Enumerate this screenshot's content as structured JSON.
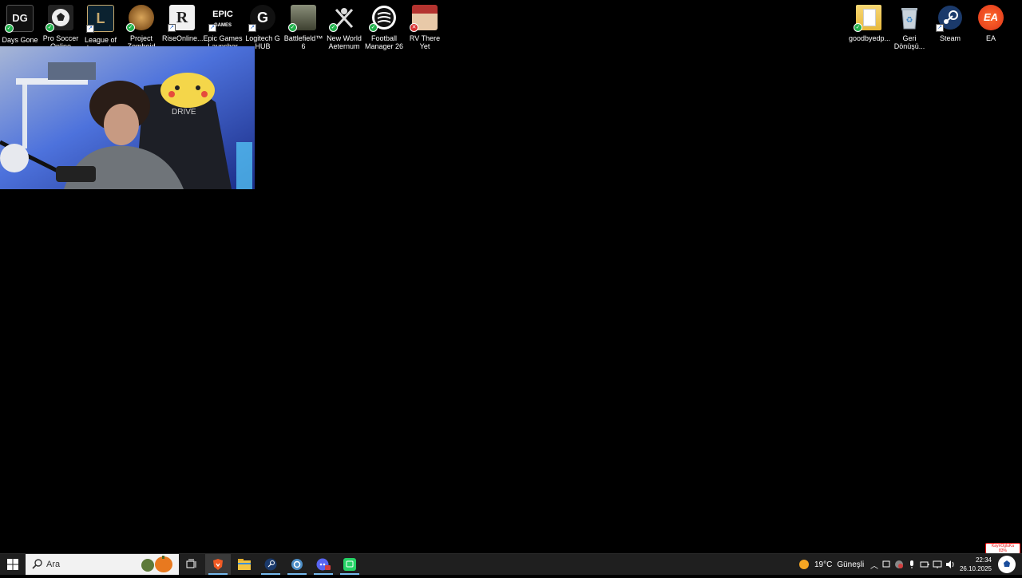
{
  "desktop": {
    "left_icons": [
      {
        "label": "Days Gone",
        "icon": "days-gone-icon",
        "status": "synced"
      },
      {
        "label": "Pro Soccer Online",
        "icon": "pro-soccer-online-icon",
        "status": "synced"
      },
      {
        "label": "League of Legends",
        "icon": "league-of-legends-icon",
        "status": "shortcut"
      },
      {
        "label": "Project Zomboid",
        "icon": "project-zomboid-icon",
        "status": "synced"
      },
      {
        "label": "RiseOnline...",
        "icon": "rise-online-icon",
        "status": "shortcut"
      },
      {
        "label": "Epic Games Launcher",
        "icon": "epic-games-icon",
        "status": "shortcut"
      },
      {
        "label": "Logitech G HUB",
        "icon": "logitech-g-hub-icon",
        "status": "shortcut"
      },
      {
        "label": "Battlefield™ 6",
        "icon": "battlefield-6-icon",
        "status": "synced"
      },
      {
        "label": "New World Aeternum",
        "icon": "new-world-icon",
        "status": "synced"
      },
      {
        "label": "Football Manager 26",
        "icon": "football-manager-icon",
        "status": "synced"
      },
      {
        "label": "RV There Yet",
        "icon": "rv-there-yet-icon",
        "status": "error"
      }
    ],
    "right_icons": [
      {
        "label": "goodbyedp...",
        "icon": "folder-icon",
        "status": "synced"
      },
      {
        "label": "Geri Dönüşü...",
        "icon": "recycle-bin-icon",
        "status": "none"
      },
      {
        "label": "Steam",
        "icon": "steam-icon",
        "status": "shortcut"
      },
      {
        "label": "EA",
        "icon": "ea-icon",
        "status": "none"
      }
    ]
  },
  "taskbar": {
    "search_placeholder": "Ara",
    "apps": [
      "task-view-icon",
      "brave-browser-icon",
      "file-explorer-icon",
      "steam-icon",
      "ubisoft-icon",
      "discord-icon",
      "whatsapp-icon"
    ],
    "weather_temp": "19°C",
    "weather_text": "Güneşli",
    "time": "22:34",
    "date": "26.10.2025",
    "notification_label": "KaynOgluKa",
    "notification_percent": "83%"
  },
  "colors": {
    "taskbar": "#1f1f1f",
    "accent": "#76b9ed",
    "sync_badge": "#23b14d",
    "error_badge": "#d9302f"
  }
}
